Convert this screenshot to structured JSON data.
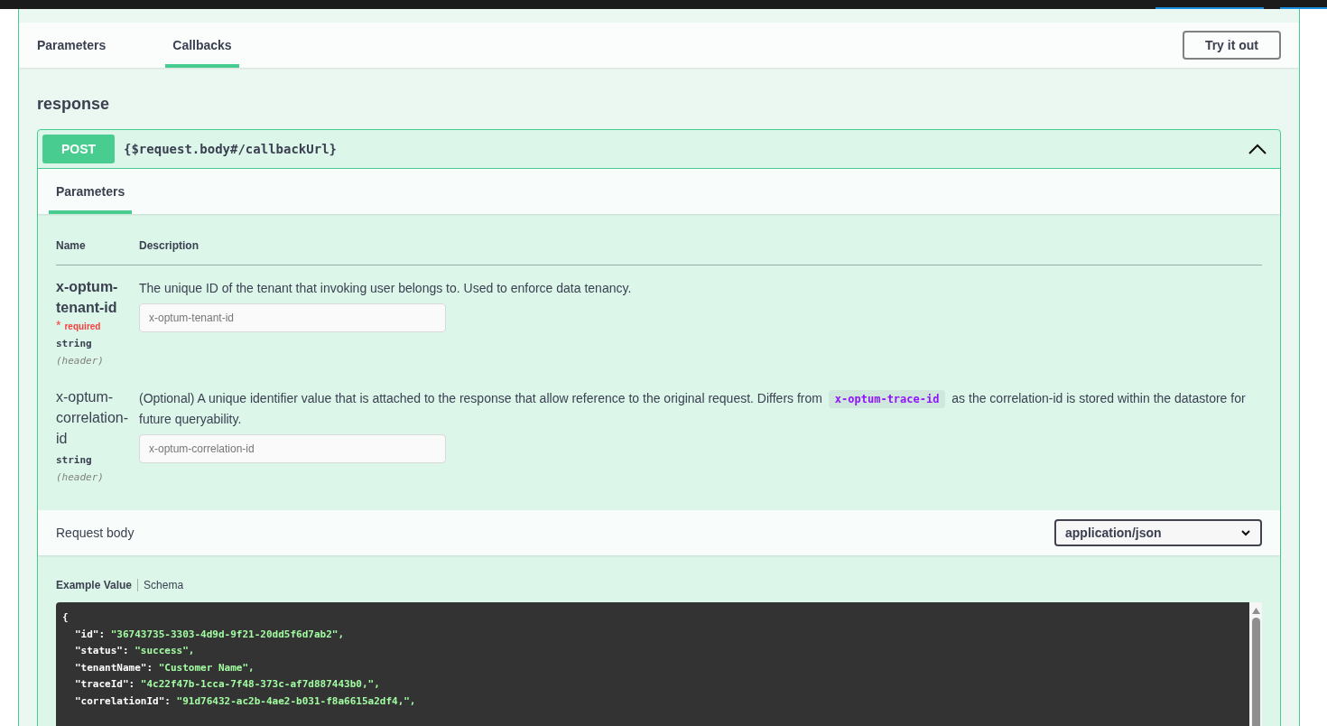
{
  "top_tabs": [
    {
      "label": "Parameters",
      "selected": false
    },
    {
      "label": "Callbacks",
      "selected": true
    }
  ],
  "try_button": "Try it out",
  "callback_name": "response",
  "operation": {
    "method": "POST",
    "path": "{$request.body#/callbackUrl}",
    "expanded": true,
    "tabs": [
      {
        "label": "Parameters",
        "selected": true
      }
    ],
    "columns": [
      "Name",
      "Description"
    ],
    "parameters": [
      {
        "name": "x-optum-tenant-id",
        "required": true,
        "required_mark": "*",
        "required_label": "required",
        "type": "string",
        "location": "(header)",
        "description": [
          {
            "kind": "text",
            "text": "The unique ID of the tenant that invoking user belongs to. Used to enforce data tenancy."
          }
        ],
        "placeholder": "x-optum-tenant-id"
      },
      {
        "name": "x-optum-correlation-id",
        "required": false,
        "type": "string",
        "location": "(header)",
        "description": [
          {
            "kind": "text",
            "text": "(Optional) A unique identifier value that is attached to the response that allow reference to the original request. Differs from "
          },
          {
            "kind": "code",
            "text": "x-optum-trace-id"
          },
          {
            "kind": "text",
            "text": " as the correlation-id is stored within the datastore for future queryability."
          }
        ],
        "placeholder": "x-optum-correlation-id"
      }
    ],
    "request_body": {
      "label": "Request body",
      "content_type": "application/json"
    },
    "example_tabs": [
      {
        "label": "Example Value",
        "selected": true
      },
      {
        "label": "Schema",
        "selected": false
      }
    ],
    "example_lines": [
      {
        "indent": false,
        "key": "{"
      },
      {
        "indent": true,
        "key": "\"id\"",
        "sep": ": ",
        "value": "\"36743735-3303-4d9d-9f21-20dd5f6d7ab2\","
      },
      {
        "indent": true,
        "key": "\"status\"",
        "sep": ": ",
        "value": "\"success\","
      },
      {
        "indent": true,
        "key": "\"tenantName\"",
        "sep": ": ",
        "value": "\"Customer Name\","
      },
      {
        "indent": true,
        "key": "\"traceId\"",
        "sep": ": ",
        "value": "\"4c22f47b-1cca-7f48-373c-af7d887443b0,\","
      },
      {
        "indent": true,
        "key": "\"correlationId\"",
        "sep": ": ",
        "value": "\"91d76432-ac2b-4ae2-b031-f8a6615a2df4,\","
      }
    ]
  }
}
